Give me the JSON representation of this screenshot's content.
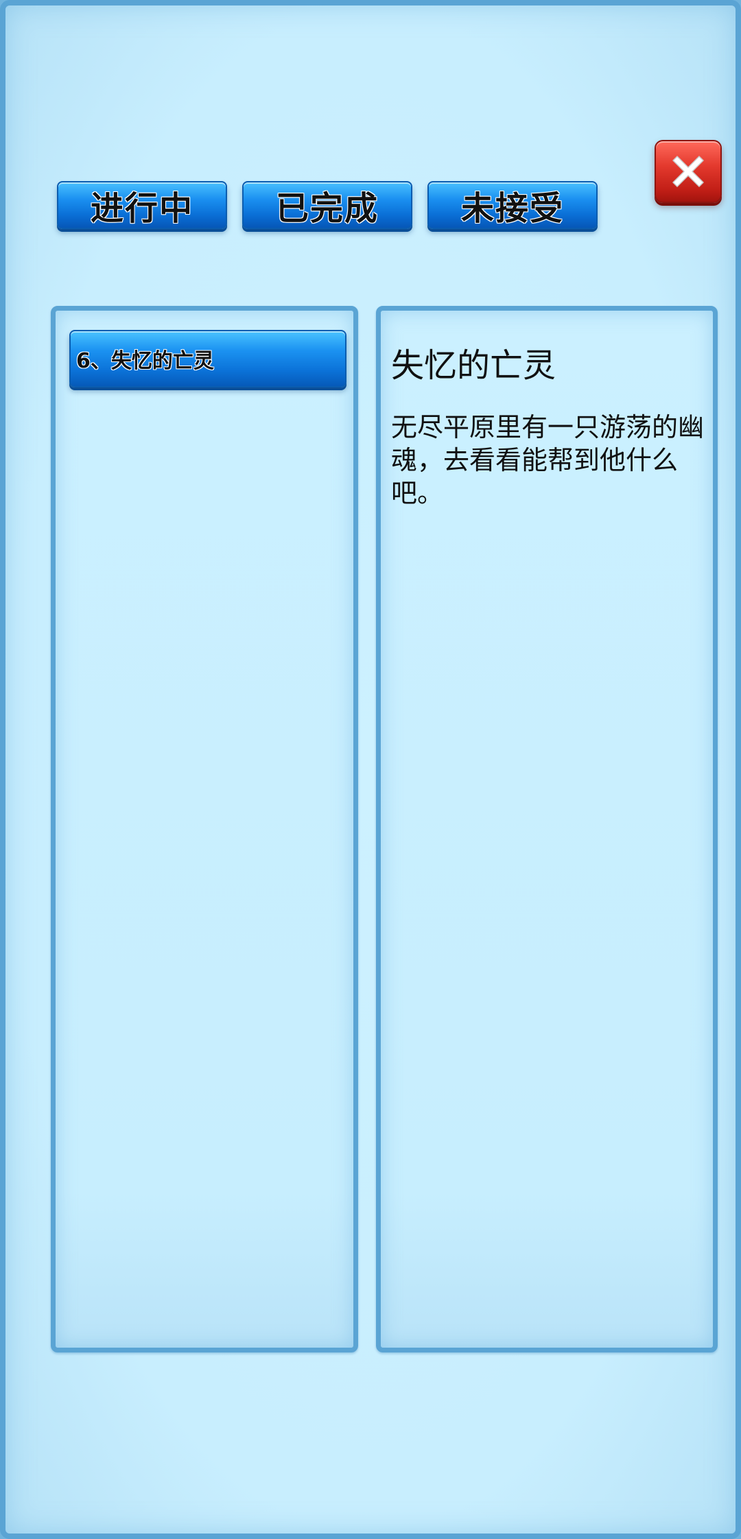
{
  "tabs": [
    {
      "id": "in_progress",
      "label": "进行中"
    },
    {
      "id": "completed",
      "label": "已完成"
    },
    {
      "id": "not_accepted",
      "label": "未接受"
    }
  ],
  "close_button": {
    "icon": "close-icon"
  },
  "quest_list": {
    "items": [
      {
        "label": "6、失忆的亡灵"
      }
    ]
  },
  "quest_detail": {
    "title": "失忆的亡灵",
    "description": "无尽平原里有一只游荡的幽魂，去看看能帮到他什么吧。"
  },
  "colors": {
    "background": "#c8eefe",
    "border": "#5aa4d4",
    "tab_blue": "#1a8ff0",
    "close_red": "#e43a2e"
  }
}
